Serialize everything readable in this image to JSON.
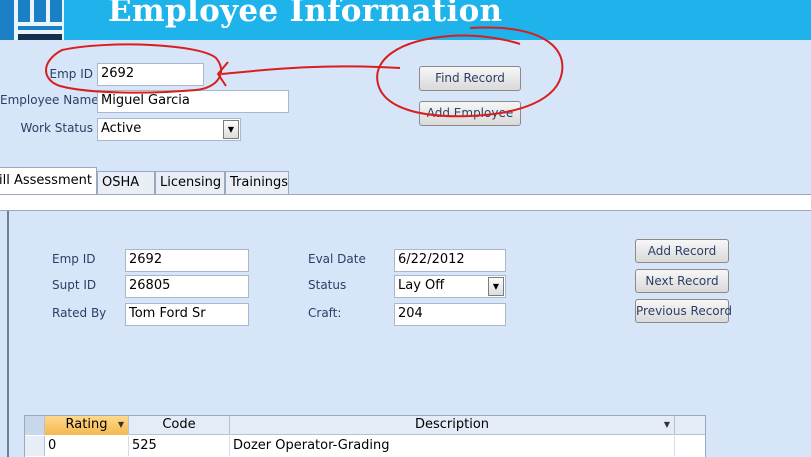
{
  "header": {
    "title": "Employee Information"
  },
  "main_form": {
    "emp_id_label": "Emp ID",
    "emp_id_value": "2692",
    "employee_name_label": "Employee Name",
    "employee_name_value": "Miguel Garcia",
    "work_status_label": "Work Status",
    "work_status_value": "Active",
    "find_record_button": "Find Record",
    "add_employee_button": "Add Employee"
  },
  "tabs": [
    {
      "label": "ill Assessment",
      "active": true
    },
    {
      "label": "OSHA"
    },
    {
      "label": "Licensing"
    },
    {
      "label": "Trainings"
    }
  ],
  "subform": {
    "emp_id_label": "Emp ID",
    "emp_id_value": "2692",
    "supt_id_label": "Supt ID",
    "supt_id_value": "26805",
    "rated_by_label": "Rated By",
    "rated_by_value": "Tom Ford Sr",
    "eval_date_label": "Eval Date",
    "eval_date_value": "6/22/2012",
    "status_label": "Status",
    "status_value": "Lay Off",
    "craft_label": "Craft:",
    "craft_value": "204",
    "add_record_button": "Add Record",
    "next_record_button": "Next Record",
    "previous_record_button": "Previous Record"
  },
  "grid": {
    "columns": [
      "Rating",
      "Code",
      "Description"
    ],
    "rows": [
      [
        "0",
        "525",
        "Dozer Operator-Grading"
      ]
    ]
  },
  "colors": {
    "header_bg": "#1eb3ea",
    "form_bg": "#d6e5f7",
    "annotation": "#d81e1e"
  }
}
